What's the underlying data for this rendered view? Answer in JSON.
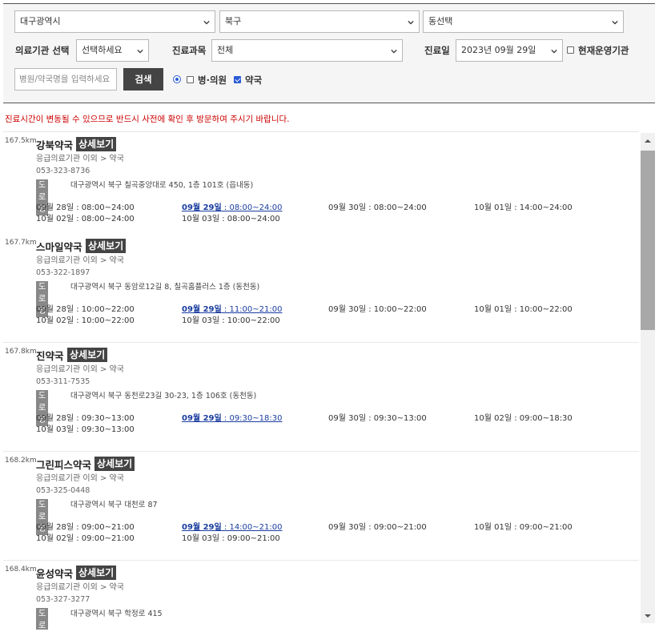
{
  "filters": {
    "city": "대구광역시",
    "district": "북구",
    "dong": "동선택",
    "institution_label": "의료기관 선택",
    "institution_value": "선택하세요",
    "dept_label": "진료과목",
    "dept_value": "전체",
    "date_label": "진료일",
    "date_value": "2023년 09월 29일",
    "open_now_label": "현재운영기관",
    "name_placeholder": "병원/약국명을 입력하세요",
    "search_label": "검색",
    "type_hospital_label": "병·의원",
    "type_pharmacy_label": "약국"
  },
  "notice": "진료시간이 변동될 수 있으므로 반드시 사전에 확인 후 방문하여 주시기 바랍니다.",
  "detail_label": "상세보기",
  "road_label": "도로명",
  "results": [
    {
      "distance": "167.5km",
      "name": "강북약국",
      "category": "응급의료기관 이외 > 약국",
      "phone": "053-323-8736",
      "address": "대구광역시 북구 칠곡중앙대로 450, 1층 101호 (읍내동)",
      "hours": [
        {
          "day": "09월 28일",
          "time": "08:00~24:00"
        },
        {
          "day": "09월 29일",
          "time": "08:00~24:00",
          "today": true
        },
        {
          "day": "09월 30일",
          "time": "08:00~24:00"
        },
        {
          "day": "10월 01일",
          "time": "14:00~24:00"
        },
        {
          "day": "10월 02일",
          "time": "08:00~24:00"
        },
        {
          "day": "10월 03일",
          "time": "08:00~24:00"
        }
      ]
    },
    {
      "distance": "167.7km",
      "name": "스마일약국",
      "category": "응급의료기관 이외 > 약국",
      "phone": "053-322-1897",
      "address": "대구광역시 북구 동암로12길 8, 칠곡홈플러스 1층 (동천동)",
      "hours": [
        {
          "day": "09월 28일",
          "time": "10:00~22:00"
        },
        {
          "day": "09월 29일",
          "time": "11:00~21:00",
          "today": true
        },
        {
          "day": "09월 30일",
          "time": "10:00~22:00"
        },
        {
          "day": "10월 01일",
          "time": "10:00~22:00"
        },
        {
          "day": "10월 02일",
          "time": "10:00~22:00"
        },
        {
          "day": "10월 03일",
          "time": "10:00~22:00"
        }
      ]
    },
    {
      "distance": "167.8km",
      "name": "진약국",
      "category": "응급의료기관 이외 > 약국",
      "phone": "053-311-7535",
      "address": "대구광역시 북구 동천로23길 30-23, 1층 106호 (동천동)",
      "hours": [
        {
          "day": "09월 28일",
          "time": "09:30~13:00"
        },
        {
          "day": "09월 29일",
          "time": "09:30~18:30",
          "today": true
        },
        {
          "day": "09월 30일",
          "time": "09:30~13:00"
        },
        {
          "day": "10월 02일",
          "time": "09:00~18:30"
        },
        {
          "day": "10월 03일",
          "time": "09:30~13:00"
        }
      ]
    },
    {
      "distance": "168.2km",
      "name": "그린피스약국",
      "category": "응급의료기관 이외 > 약국",
      "phone": "053-325-0448",
      "address": "대구광역시 북구 대천로 87",
      "hours": [
        {
          "day": "09월 28일",
          "time": "09:00~21:00"
        },
        {
          "day": "09월 29일",
          "time": "14:00~21:00",
          "today": true
        },
        {
          "day": "09월 30일",
          "time": "09:00~21:00"
        },
        {
          "day": "10월 01일",
          "time": "09:00~21:00"
        },
        {
          "day": "10월 02일",
          "time": "09:00~21:00"
        },
        {
          "day": "10월 03일",
          "time": "09:00~21:00"
        }
      ]
    },
    {
      "distance": "168.4km",
      "name": "윤성약국",
      "category": "응급의료기관 이외 > 약국",
      "phone": "053-327-3277",
      "address": "대구광역시 북구 학정로 415",
      "hours": []
    }
  ]
}
